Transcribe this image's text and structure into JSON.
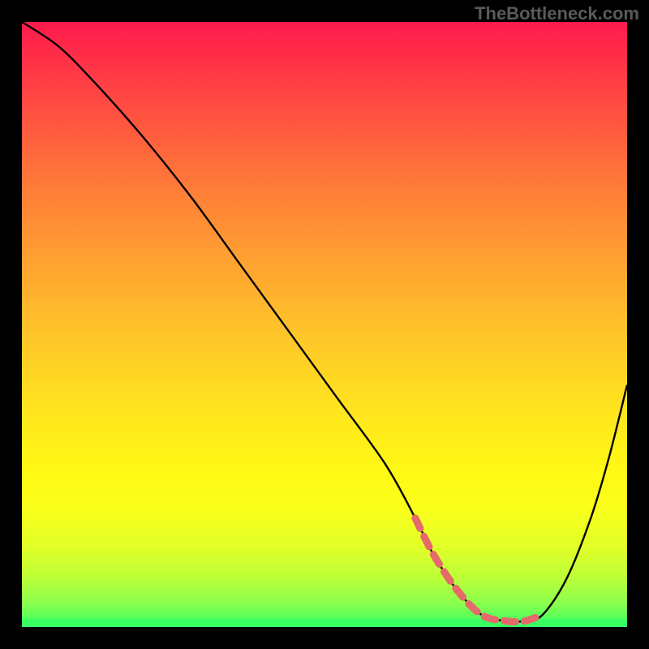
{
  "watermark": "TheBottleneck.com",
  "chart_data": {
    "type": "line",
    "title": "",
    "xlabel": "",
    "ylabel": "",
    "xlim": [
      0,
      100
    ],
    "ylim": [
      0,
      100
    ],
    "series": [
      {
        "name": "bottleneck-curve",
        "x": [
          0,
          6,
          12,
          20,
          28,
          36,
          44,
          52,
          60,
          65,
          68,
          72,
          76,
          80,
          83,
          86,
          90,
          94,
          97,
          100
        ],
        "y": [
          100,
          96,
          90,
          81,
          71,
          60,
          49,
          38,
          27,
          18,
          12,
          6,
          2,
          1,
          1,
          2,
          8,
          18,
          28,
          40
        ]
      }
    ],
    "highlight_range_x": [
      66,
      85
    ],
    "optimal_x": 78,
    "gradient_stops": [
      {
        "pos": 0,
        "color": "#ff1a4d"
      },
      {
        "pos": 7,
        "color": "#ff3347"
      },
      {
        "pos": 16,
        "color": "#ff5440"
      },
      {
        "pos": 28,
        "color": "#ff7e38"
      },
      {
        "pos": 39,
        "color": "#ffa031"
      },
      {
        "pos": 52,
        "color": "#ffc629"
      },
      {
        "pos": 64,
        "color": "#ffe41e"
      },
      {
        "pos": 74,
        "color": "#fff814"
      },
      {
        "pos": 80,
        "color": "#fbff1a"
      },
      {
        "pos": 87,
        "color": "#e0ff28"
      },
      {
        "pos": 92,
        "color": "#baff38"
      },
      {
        "pos": 96,
        "color": "#8cff4d"
      },
      {
        "pos": 100,
        "color": "#39ff62"
      }
    ],
    "highlight_color": "#e66a6a",
    "curve_color": "#000000"
  }
}
